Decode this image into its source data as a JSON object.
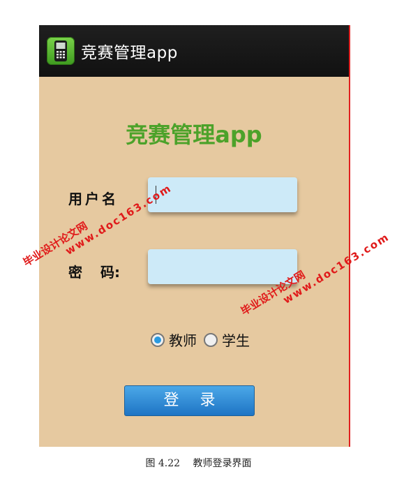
{
  "actionbar": {
    "title": "竞赛管理app",
    "icon": "phone-app-icon"
  },
  "page": {
    "title": "竞赛管理app"
  },
  "form": {
    "username_label": "用户名",
    "password_label_1": "密",
    "password_label_2": "码:",
    "username_value": "",
    "password_value": ""
  },
  "roles": {
    "teacher": "教师",
    "student": "学生",
    "selected": "教师"
  },
  "login_button": "登录",
  "watermark": {
    "line1": "毕业设计论文网",
    "line2": "www.doc163.com"
  },
  "caption": "图 4.22　 教师登录界面",
  "colors": {
    "background": "#e6c9a0",
    "title_green": "#4ca22a",
    "field_blue": "#cdeaf8",
    "button_blue": "#2a8ad6",
    "watermark_red": "#e01a1a"
  }
}
